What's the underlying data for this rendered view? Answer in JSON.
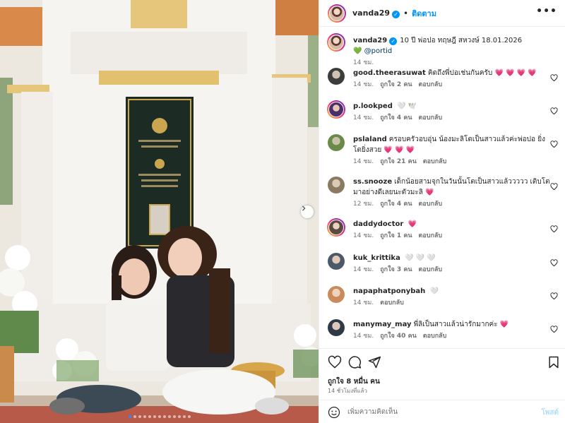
{
  "header": {
    "username": "vanda29",
    "separator": "•",
    "follow_label": "ติดตาม",
    "more_icon": "more-horizontal-icon"
  },
  "caption": {
    "username": "vanda29",
    "text": "10 ปี พ่อปอ ทฤษฎี สหวงษ์ 18.01.2026",
    "emoji": "💚",
    "mention": "@portid",
    "time": "14 ชม."
  },
  "comments": [
    {
      "user": "good.theerasuwat",
      "text": "คิดถึงพี่ปอเช่นกันครับ",
      "emoji": "💗 💗 💗 💗",
      "emoji_color": "heart",
      "time": "14 ชม.",
      "likes": "ถูกใจ 2 คน",
      "reply": "ตอบกลับ"
    },
    {
      "user": "p.lookped",
      "text": "",
      "emoji": "🤍 🕊️",
      "emoji_color": "purple",
      "time": "14 ชม.",
      "likes": "ถูกใจ 4 คน",
      "reply": "ตอบกลับ"
    },
    {
      "user": "pslaland",
      "text": "ครอบครัวอบอุ่น น้องมะลิโตเป็นสาวแล้วค่ะพ่อปอ ยิ่งโตยิ่งสวย",
      "emoji": "💗 💗 💗",
      "emoji_color": "heart",
      "time": "14 ชม.",
      "likes": "ถูกใจ 21 คน",
      "reply": "ตอบกลับ"
    },
    {
      "user": "ss.snooze",
      "text": "เด็กน้อยสามจุกในวันนั้นโตเป็นสาวแล้ววววว เติบโตมาอย่างดีเลยนะตัวมะลิ",
      "emoji": "💗",
      "emoji_color": "heart",
      "time": "12 ชม.",
      "likes": "ถูกใจ 4 คน",
      "reply": "ตอบกลับ"
    },
    {
      "user": "daddydoctor",
      "text": "",
      "emoji": "💗",
      "emoji_color": "heart",
      "time": "14 ชม.",
      "likes": "ถูกใจ 1 คน",
      "reply": "ตอบกลับ"
    },
    {
      "user": "kuk_krittika",
      "text": "",
      "emoji": "🤍 🤍 🤍",
      "emoji_color": "purple",
      "time": "14 ชม.",
      "likes": "ถูกใจ 3 คน",
      "reply": "ตอบกลับ"
    },
    {
      "user": "napaphatponybah",
      "text": "",
      "emoji": "🤍",
      "emoji_color": "purple",
      "time": "14 ชม.",
      "likes": "",
      "reply": "ตอบกลับ"
    },
    {
      "user": "manymay_may",
      "text": "พี่ลิเป็นสาวแล้วน่ารักมากค่ะ",
      "emoji": "💗",
      "emoji_color": "heart",
      "time": "14 ชม.",
      "likes": "ถูกใจ 40 คน",
      "reply": "ตอบกลับ"
    }
  ],
  "actions": {
    "like_icon": "heart-icon",
    "comment_icon": "comment-icon",
    "share_icon": "send-icon",
    "save_icon": "bookmark-icon",
    "likes_text": "ถูกใจ 8 หมื่น คน",
    "time_text": "14 ชั่วโมงที่แล้ว"
  },
  "composer": {
    "placeholder": "เพิ่มความคิดเห็น",
    "post_label": "โพสต์",
    "emoji_icon": "emoji-icon"
  },
  "carousel": {
    "next_icon": "chevron-right-icon",
    "total_slides": 13,
    "active_index": 0
  },
  "colors": {
    "accent": "#0095f6",
    "heart": "#ed4956",
    "muted": "#737373"
  }
}
